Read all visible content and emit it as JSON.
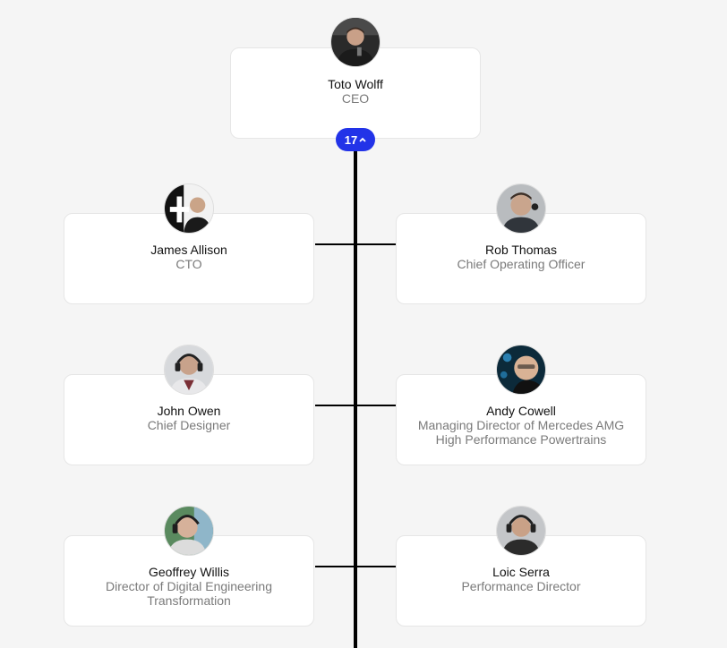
{
  "colors": {
    "background": "#f5f5f5",
    "card": "#ffffff",
    "connector": "#000000",
    "badge": "#2233e8",
    "name_text": "#111111",
    "title_text": "#7a7a7a"
  },
  "root": {
    "name": "Toto Wolff",
    "title": "CEO",
    "avatar": "person-photo",
    "reports_count": "17",
    "toggle_icon": "chevron-up-icon"
  },
  "reports": [
    {
      "name": "James Allison",
      "title": "CTO",
      "avatar": "person-photo"
    },
    {
      "name": "Rob Thomas",
      "title": "Chief Operating Officer",
      "avatar": "person-photo"
    },
    {
      "name": "John Owen",
      "title": "Chief Designer",
      "avatar": "person-photo"
    },
    {
      "name": "Andy Cowell",
      "title": "Managing Director of Mercedes AMG High Performance Powertrains",
      "avatar": "person-photo"
    },
    {
      "name": "Geoffrey Willis",
      "title": "Director of Digital Engineering Transformation",
      "avatar": "person-photo"
    },
    {
      "name": "Loic Serra",
      "title": "Performance Director",
      "avatar": "person-photo"
    }
  ]
}
